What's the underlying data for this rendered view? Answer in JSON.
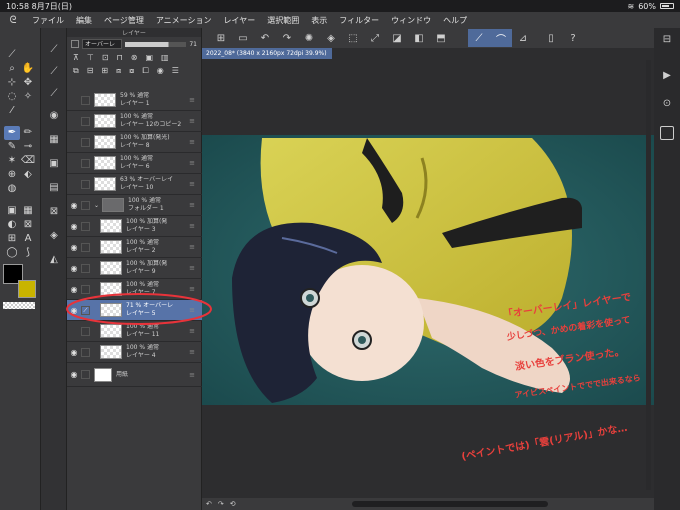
{
  "status_bar": {
    "time": "10:58",
    "date": "8月7日(日)",
    "battery": "60%",
    "battery_level": 0.6
  },
  "menu": {
    "items": [
      "ファイル",
      "編集",
      "ページ管理",
      "アニメーション",
      "レイヤー",
      "選択範囲",
      "表示",
      "フィルター",
      "ウィンドウ",
      "ヘルプ"
    ]
  },
  "document_tab": {
    "label": "2022_08* (3840 x 2160px 72dpi 39.9%)"
  },
  "layer_panel": {
    "title": "レイヤー",
    "blend_mode": "オーバーレ",
    "opacity": "71",
    "layers": [
      {
        "mode": "59 % 通常",
        "name": "レイヤー 1",
        "visible": false,
        "indent": 0
      },
      {
        "mode": "100 % 通常",
        "name": "レイヤー 12のコピー2",
        "visible": false,
        "indent": 0
      },
      {
        "mode": "100 % 加算(発光)",
        "name": "レイヤー 8",
        "visible": false,
        "indent": 0
      },
      {
        "mode": "100 % 通常",
        "name": "レイヤー 6",
        "visible": false,
        "indent": 0
      },
      {
        "mode": "63 % オーバーレイ",
        "name": "レイヤー 10",
        "visible": false,
        "indent": 0
      },
      {
        "mode": "100 % 通常",
        "name": "フォルダー 1",
        "visible": true,
        "indent": 0,
        "folder": true
      },
      {
        "mode": "100 % 加算(発",
        "name": "レイヤー 3",
        "visible": true,
        "indent": 1
      },
      {
        "mode": "100 % 通常",
        "name": "レイヤー 2",
        "visible": true,
        "indent": 1
      },
      {
        "mode": "100 % 加算(発",
        "name": "レイヤー 9",
        "visible": true,
        "indent": 1
      },
      {
        "mode": "100 % 通常",
        "name": "レイヤー 7",
        "visible": true,
        "indent": 1
      },
      {
        "mode": "71 % オーバーレ",
        "name": "レイヤー 5",
        "visible": true,
        "indent": 1,
        "active": true
      },
      {
        "mode": "100 % 通常",
        "name": "レイヤー 11",
        "visible": false,
        "indent": 1
      },
      {
        "mode": "100 % 通常",
        "name": "レイヤー 4",
        "visible": true,
        "indent": 1
      },
      {
        "mode": "",
        "name": "用紙",
        "visible": true,
        "indent": 0,
        "paper": true
      }
    ]
  },
  "colors": {
    "main": "#000000",
    "sub": "#c9b400",
    "accent": "#5773a8",
    "annotation": "#e8403c"
  },
  "annotation": {
    "line1": "「オーバーレイ」レイヤーで",
    "line2": "少しづつ、かめの着彩を使って",
    "line3": "淡い色をブラン使った。",
    "line4": "アイビスペイントででで出来るなら",
    "line5": "(ペイントでは)「雲(リアル)」かな…"
  }
}
